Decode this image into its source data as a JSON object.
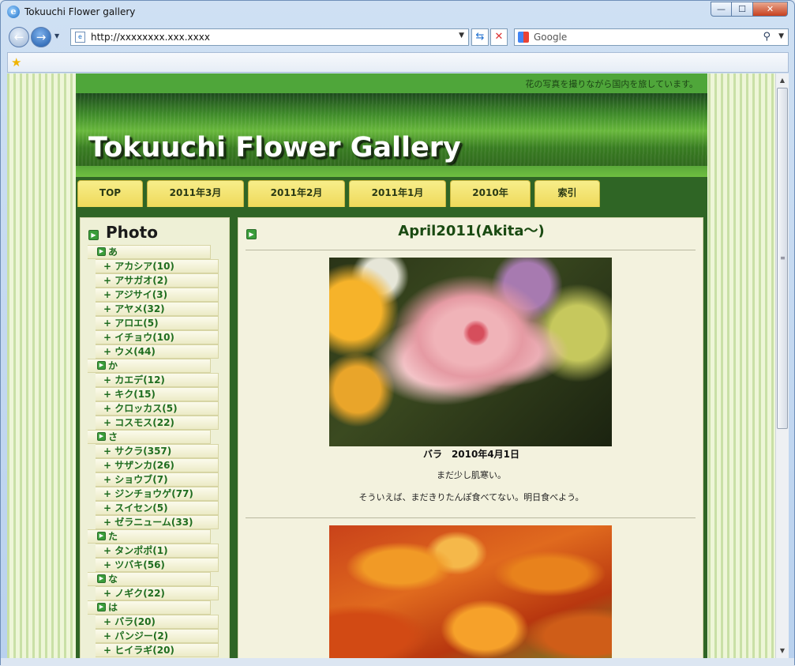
{
  "window": {
    "title": "Tokuuchi Flower gallery",
    "buttons": {
      "min": "—",
      "max": "☐",
      "close": "✕"
    }
  },
  "toolbar": {
    "url": "http://xxxxxxxx.xxx.xxxx",
    "search_placeholder": "Google",
    "icons": [
      "ie-logo-icon",
      "back-arrow-icon",
      "forward-arrow-icon",
      "refresh-icon",
      "stop-icon",
      "search-icon",
      "favorites-star-icon"
    ]
  },
  "site": {
    "tagline": "花の写真を撮りながら国内を旅しています。",
    "title": "Tokuuchi Flower Gallery",
    "tabs": [
      "TOP",
      "2011年3月",
      "2011年2月",
      "2011年1月",
      "2010年",
      "索引"
    ]
  },
  "sidebar": {
    "title": "Photo",
    "categories": [
      {
        "label": "あ",
        "items": [
          "アカシア(10)",
          "アサガオ(2)",
          "アジサイ(3)",
          "アヤメ(32)",
          "アロエ(5)",
          "イチョウ(10)",
          "ウメ(44)"
        ]
      },
      {
        "label": "か",
        "items": [
          "カエデ(12)",
          "キク(15)",
          "クロッカス(5)",
          "コスモス(22)"
        ]
      },
      {
        "label": "さ",
        "items": [
          "サクラ(357)",
          "サザンカ(26)",
          "ショウブ(7)",
          "ジンチョウゲ(77)",
          "スイセン(5)",
          "ゼラニューム(33)"
        ]
      },
      {
        "label": "た",
        "items": [
          "タンポポ(1)",
          "ツバキ(56)"
        ]
      },
      {
        "label": "な",
        "items": [
          "ノギク(22)"
        ]
      },
      {
        "label": "は",
        "items": [
          "バラ(20)",
          "パンジー(2)",
          "ヒイラギ(20)"
        ]
      }
    ]
  },
  "main": {
    "heading": "April2011(Akita～)",
    "caption": "バラ　2010年4月1日",
    "desc1": "まだ少し肌寒い。",
    "desc2": "そういえば、まだきりたんぽ食べてない。明日食べよう。"
  }
}
